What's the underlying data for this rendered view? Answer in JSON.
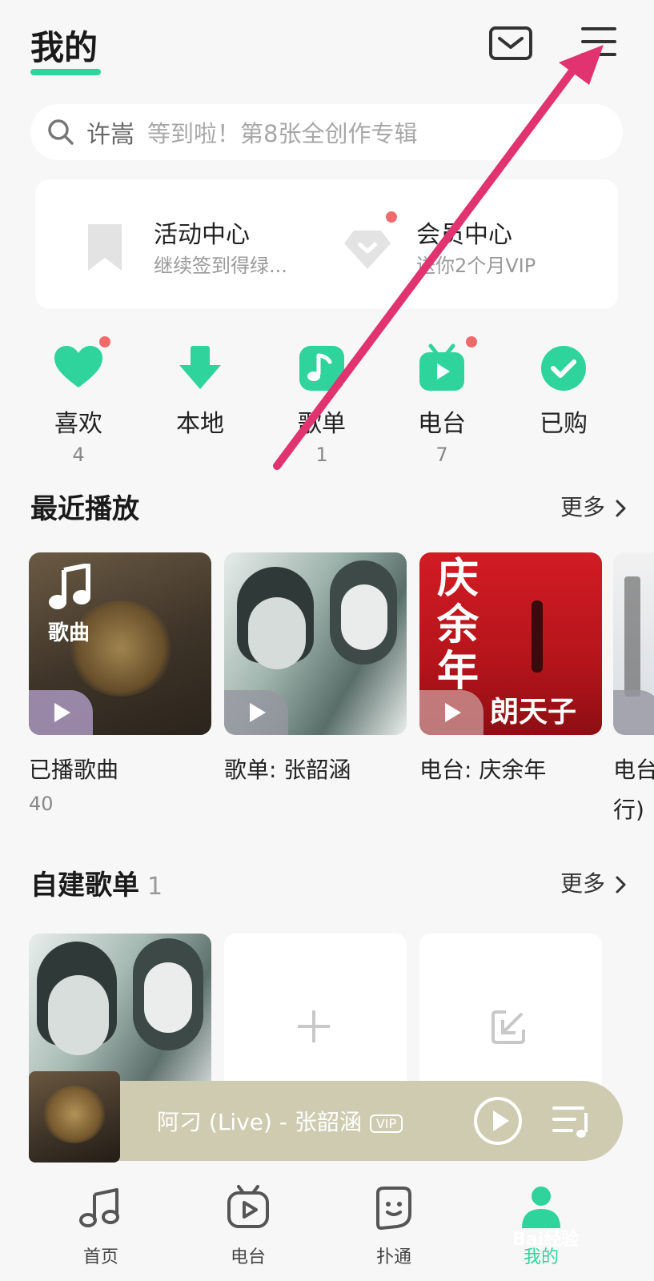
{
  "header": {
    "title": "我的"
  },
  "search": {
    "query": "许嵩",
    "hint": "等到啦！第8张全创作专辑"
  },
  "promo": {
    "activity_title": "活动中心",
    "activity_sub": "继续签到得绿...",
    "member_title": "会员中心",
    "member_sub": "送你2个月VIP"
  },
  "quick": {
    "items": [
      {
        "label": "喜欢",
        "count": "4",
        "icon": "heart-icon"
      },
      {
        "label": "本地",
        "count": "",
        "icon": "download-icon"
      },
      {
        "label": "歌单",
        "count": "1",
        "icon": "music-note-icon"
      },
      {
        "label": "电台",
        "count": "7",
        "icon": "radio-tv-icon"
      },
      {
        "label": "已购",
        "count": "",
        "icon": "check-icon"
      }
    ]
  },
  "recent": {
    "title": "最近播放",
    "more": "更多",
    "cards": [
      {
        "title": "已播歌曲",
        "sub": "40",
        "overlay": "歌曲"
      },
      {
        "title": "歌单: 张韶涵",
        "sub": ""
      },
      {
        "title": "电台: 庆余年",
        "sub": "",
        "cover_text_1": "庆",
        "cover_text_2": "余",
        "cover_text_3": "年",
        "cover_text_4": "朗天子"
      },
      {
        "title": "电台",
        "sub": "行)"
      }
    ]
  },
  "playlists": {
    "title": "自建歌单",
    "count": "1",
    "more": "更多"
  },
  "player": {
    "song": "阿刁 (Live) - 张韶涵",
    "vip": "VIP"
  },
  "tabs": [
    {
      "label": "首页"
    },
    {
      "label": "电台"
    },
    {
      "label": "扑通"
    },
    {
      "label": "我的"
    }
  ],
  "colors": {
    "accent": "#2fd49c",
    "badge": "#ef6a6a",
    "arrow": "#e0336f",
    "player_bg": "#cfcbb0"
  },
  "watermark": "Bai经验"
}
